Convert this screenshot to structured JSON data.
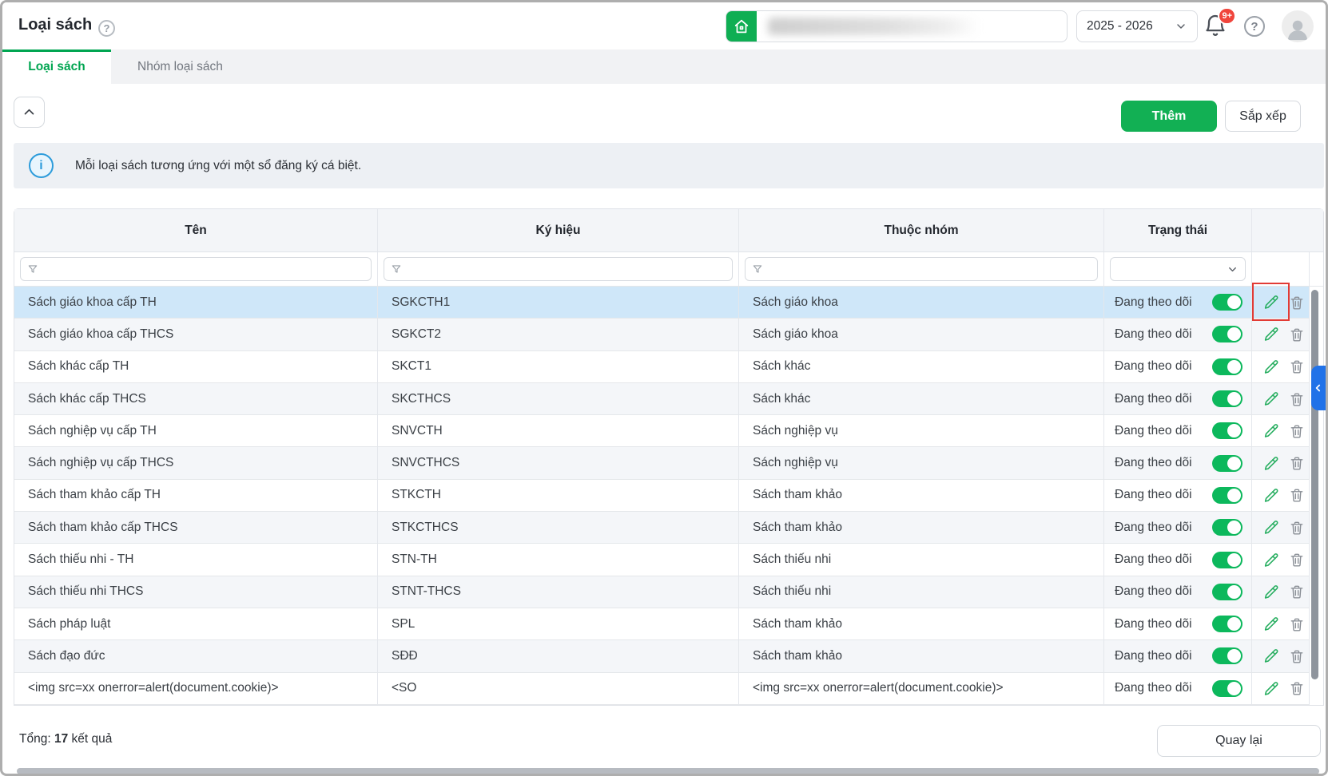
{
  "window": {
    "title": "Loại sách"
  },
  "topbar": {
    "year": "2025 - 2026",
    "notification_badge": "9+"
  },
  "tabs": [
    {
      "label": "Loại sách",
      "active": true
    },
    {
      "label": "Nhóm loại sách",
      "active": false
    }
  ],
  "toolbar": {
    "add_label": "Thêm",
    "sort_label": "Sắp xếp"
  },
  "banner": {
    "text": "Mỗi loại sách tương ứng với một sổ đăng ký cá biệt."
  },
  "table": {
    "columns": [
      "Tên",
      "Ký hiệu",
      "Thuộc nhóm",
      "Trạng thái"
    ],
    "rows": [
      {
        "name": "Sách giáo khoa cấp TH",
        "code": "SGKCTH1",
        "group": "Sách giáo khoa",
        "status": "Đang theo dõi",
        "enabled": true,
        "selected": true,
        "edit_highlighted": true
      },
      {
        "name": "Sách giáo khoa cấp THCS",
        "code": "SGKCT2",
        "group": "Sách giáo khoa",
        "status": "Đang theo dõi",
        "enabled": true,
        "selected": false,
        "edit_highlighted": false
      },
      {
        "name": "Sách khác cấp TH",
        "code": "SKCT1",
        "group": "Sách khác",
        "status": "Đang theo dõi",
        "enabled": true,
        "selected": false,
        "edit_highlighted": false
      },
      {
        "name": "Sách khác cấp THCS",
        "code": "SKCTHCS",
        "group": "Sách khác",
        "status": "Đang theo dõi",
        "enabled": true,
        "selected": false,
        "edit_highlighted": false
      },
      {
        "name": "Sách nghiệp vụ cấp TH",
        "code": "SNVCTH",
        "group": "Sách nghiệp vụ",
        "status": "Đang theo dõi",
        "enabled": true,
        "selected": false,
        "edit_highlighted": false
      },
      {
        "name": "Sách nghiệp vụ cấp THCS",
        "code": "SNVCTHCS",
        "group": "Sách nghiệp vụ",
        "status": "Đang theo dõi",
        "enabled": true,
        "selected": false,
        "edit_highlighted": false
      },
      {
        "name": "Sách tham khảo cấp TH",
        "code": "STKCTH",
        "group": "Sách tham khảo",
        "status": "Đang theo dõi",
        "enabled": true,
        "selected": false,
        "edit_highlighted": false
      },
      {
        "name": "Sách tham khảo cấp THCS",
        "code": "STKCTHCS",
        "group": "Sách tham khảo",
        "status": "Đang theo dõi",
        "enabled": true,
        "selected": false,
        "edit_highlighted": false
      },
      {
        "name": "Sách thiếu nhi - TH",
        "code": "STN-TH",
        "group": "Sách thiếu nhi",
        "status": "Đang theo dõi",
        "enabled": true,
        "selected": false,
        "edit_highlighted": false
      },
      {
        "name": "Sách thiếu nhi THCS",
        "code": "STNT-THCS",
        "group": "Sách thiếu nhi",
        "status": "Đang theo dõi",
        "enabled": true,
        "selected": false,
        "edit_highlighted": false
      },
      {
        "name": "Sách pháp luật",
        "code": "SPL",
        "group": "Sách tham khảo",
        "status": "Đang theo dõi",
        "enabled": true,
        "selected": false,
        "edit_highlighted": false
      },
      {
        "name": "Sách đạo đức",
        "code": "SĐĐ",
        "group": "Sách tham khảo",
        "status": "Đang theo dõi",
        "enabled": true,
        "selected": false,
        "edit_highlighted": false
      },
      {
        "name": "<img src=xx onerror=alert(document.cookie)>",
        "code": "<SO",
        "group": "<img src=xx onerror=alert(document.cookie)>",
        "status": "Đang theo dõi",
        "enabled": true,
        "selected": false,
        "edit_highlighted": false
      }
    ]
  },
  "footer": {
    "total_label": "Tổng:",
    "total_value": "17",
    "total_suffix": " kết quả",
    "back_label": "Quay lại"
  },
  "colors": {
    "accent_green": "#12b054",
    "tab_green": "#00a551",
    "toggle_green": "#0cb85c",
    "selected_row": "#cfe7f9",
    "highlight_red": "#e23b35",
    "handle_blue": "#2172e8",
    "badge_red": "#f0453c"
  }
}
